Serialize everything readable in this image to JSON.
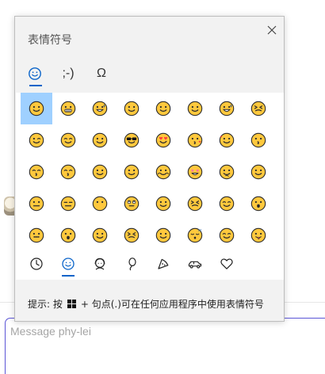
{
  "panel": {
    "title": "表情符号",
    "category_tabs": [
      {
        "id": "emoji",
        "label": "",
        "icon": "smiley-face-icon",
        "active": true
      },
      {
        "id": "kaomoji",
        "label": ";-)",
        "icon": "",
        "active": false
      },
      {
        "id": "symbols",
        "label": "Ω",
        "icon": "",
        "active": false
      }
    ],
    "emoji_grid": [
      [
        "grinning-face",
        "grimacing-face",
        "face-with-tears-of-joy",
        "rolling-on-floor-laughing",
        "grinning-face",
        "smiling-face",
        "grinning-face-with-sweat",
        "grinning-squinting-face"
      ],
      [
        "winking-face",
        "smiling-face-with-smiling-eyes",
        "face-savoring-food",
        "smiling-face-with-sunglasses",
        "smiling-face-with-heart-eyes",
        "face-blowing-a-kiss",
        "smiling-face-with-hearts",
        "kissing-face"
      ],
      [
        "kissing-face-with-smiling-eyes",
        "kissing-face-with-closed-eyes",
        "smiling-face",
        "slightly-smiling-face",
        "hugging-face",
        "star-struck",
        "thinking-face",
        "face-with-raised-eyebrow"
      ],
      [
        "neutral-face",
        "expressionless-face",
        "face-without-mouth",
        "face-with-rolling-eyes",
        "smirking-face",
        "persevering-face",
        "sad-but-relieved-face",
        "face-with-open-mouth"
      ],
      [
        "zipper-mouth-face",
        "hushed-face",
        "sleepy-face",
        "tired-face",
        "face-with-hand-over-mouth",
        "sleeping-face",
        "relieved-face",
        "face-with-tongue"
      ]
    ],
    "selected_index": [
      0,
      0
    ],
    "subcategory_tabs": [
      {
        "icon": "clock-icon",
        "active": false
      },
      {
        "icon": "smiley-icon",
        "active": true
      },
      {
        "icon": "person-icon",
        "active": false
      },
      {
        "icon": "balloon-icon",
        "active": false
      },
      {
        "icon": "pizza-icon",
        "active": false
      },
      {
        "icon": "car-icon",
        "active": false
      },
      {
        "icon": "heart-icon",
        "active": false
      }
    ],
    "tip_prefix": "提示: 按",
    "tip_suffix": "+ 句点(.)可在任何应用程序中使用表情符号"
  },
  "composer": {
    "placeholder": "Message phy-lei"
  },
  "colors": {
    "accent": "#0a64c9",
    "selected_bg": "#9fd0ff",
    "composer_border": "#5b55d6",
    "emoji_yellow": "#ffc83d",
    "emoji_outline": "#2b2b2b"
  }
}
